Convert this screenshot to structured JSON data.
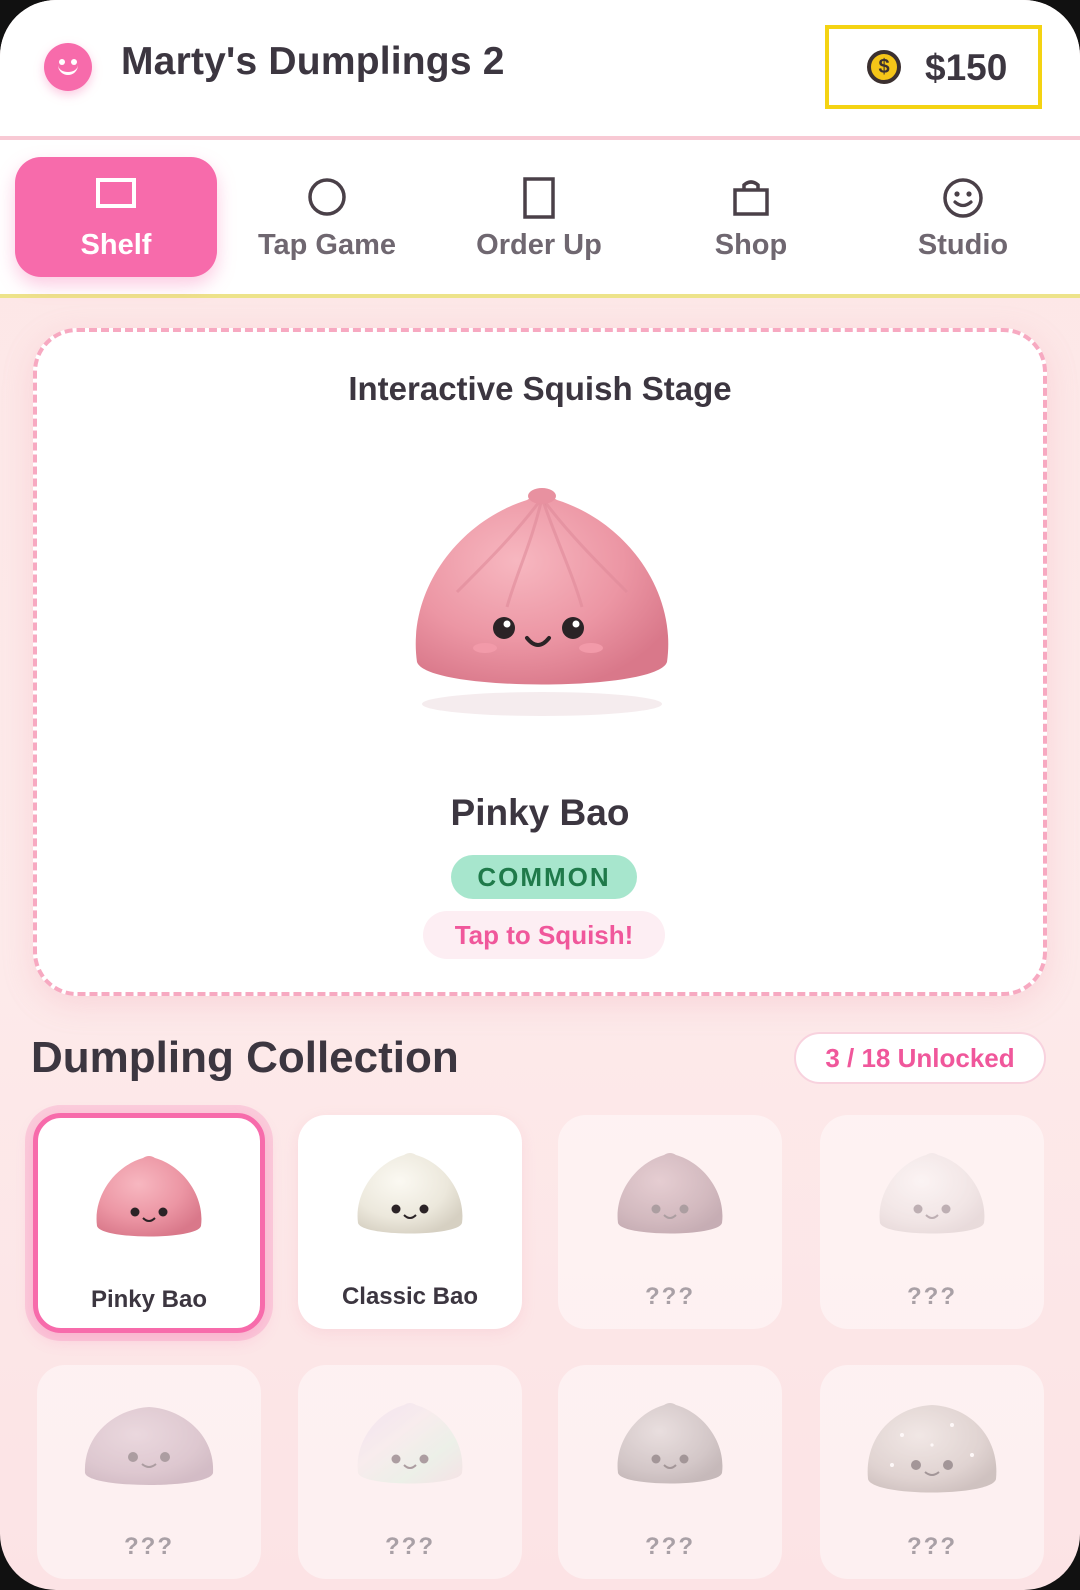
{
  "header": {
    "app_title": "Marty's Dumplings 2",
    "balance": "$150",
    "coin_symbol": "$"
  },
  "nav": {
    "tabs": [
      {
        "label": "Shelf",
        "icon": "rectangle-icon",
        "active": true
      },
      {
        "label": "Tap Game",
        "icon": "circle-icon",
        "active": false
      },
      {
        "label": "Order Up",
        "icon": "tall-rectangle-icon",
        "active": false
      },
      {
        "label": "Shop",
        "icon": "shopping-bag-icon",
        "active": false
      },
      {
        "label": "Studio",
        "icon": "smiley-icon",
        "active": false
      }
    ]
  },
  "stage": {
    "title": "Interactive Squish Stage",
    "character_name": "Pinky Bao",
    "rarity": "COMMON",
    "action_label": "Tap to Squish!"
  },
  "collection": {
    "title": "Dumpling Collection",
    "unlocked_label": "3 / 18 Unlocked",
    "items": [
      {
        "name": "Pinky Bao",
        "locked": false,
        "selected": true,
        "color": "#ec9aa6"
      },
      {
        "name": "Classic Bao",
        "locked": false,
        "selected": false,
        "color": "#eeeae0"
      },
      {
        "name": "???",
        "locked": true,
        "selected": false,
        "color": "#b9939d"
      },
      {
        "name": "???",
        "locked": true,
        "selected": false,
        "color": "#eadfe0"
      },
      {
        "name": "???",
        "locked": true,
        "selected": false,
        "color": "#c9a9b5"
      },
      {
        "name": "???",
        "locked": true,
        "selected": false,
        "color": "#e8e0ea"
      },
      {
        "name": "???",
        "locked": true,
        "selected": false,
        "color": "#b7a9ab"
      },
      {
        "name": "???",
        "locked": true,
        "selected": false,
        "color": "#cfc3c1"
      }
    ]
  }
}
